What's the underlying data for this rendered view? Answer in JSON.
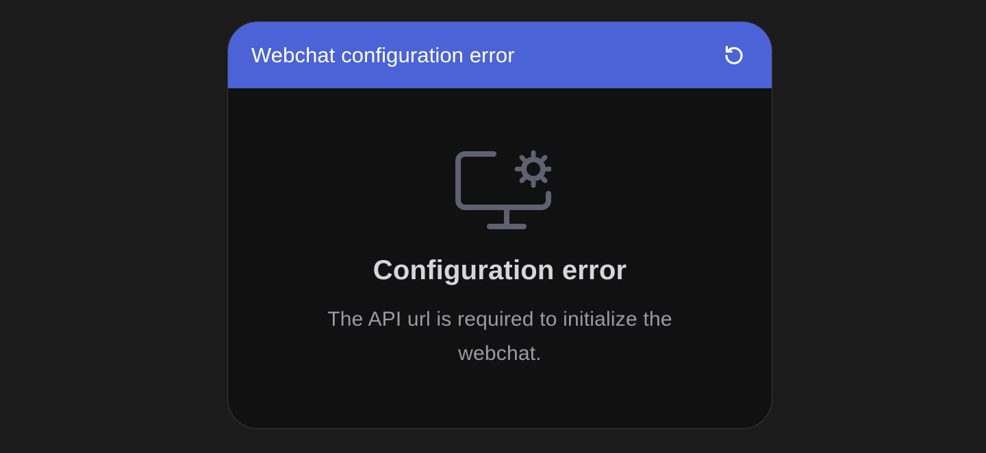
{
  "widget": {
    "header": {
      "title": "Webchat configuration error",
      "reload_icon": "reload-icon",
      "color": "#4b63d6"
    },
    "body": {
      "illustration_icon": "monitor-settings-icon",
      "title": "Configuration error",
      "message": "The API url is required to initialize the webchat."
    }
  }
}
